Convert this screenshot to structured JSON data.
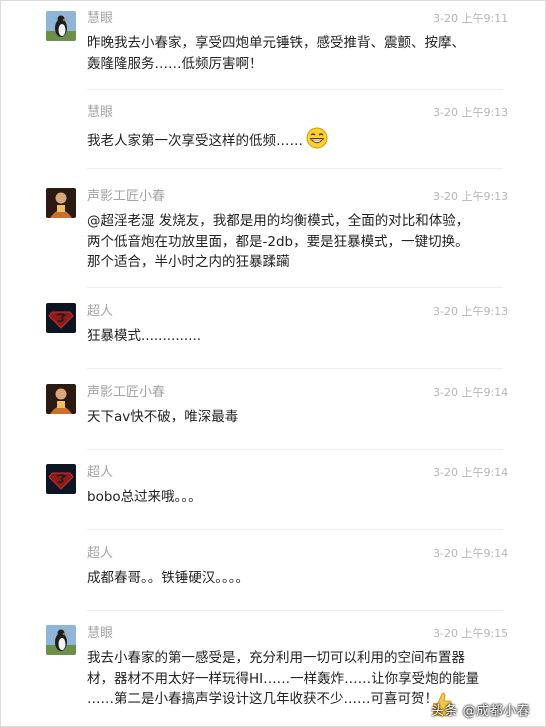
{
  "comments": [
    {
      "user": "慧眼",
      "time": "3-20 上午9:11",
      "lines": [
        "昨晚我去小春家，享受四炮单元锤铁，感受推背、震颤、按摩、",
        "轰隆隆服务……低频厉害啊！"
      ]
    },
    {
      "user": "慧眼",
      "time": "3-20 上午9:13",
      "lines": [
        "我老人家第一次享受这样的低频……"
      ]
    },
    {
      "user": "声影工匠小春",
      "time": "3-20 上午9:13",
      "lines": [
        "@超淫老湿 发烧友，我都是用的均衡模式，全面的对比和体验，",
        "两个低音炮在功放里面，都是-2db，要是狂暴模式，一键切换。",
        "那个适合，半小时之内的狂暴蹂躏"
      ]
    },
    {
      "user": "超人",
      "time": "3-20 上午9:13",
      "lines": [
        "狂暴模式.............."
      ]
    },
    {
      "user": "声影工匠小春",
      "time": "3-20 上午9:14",
      "lines": [
        "天下av快不破，唯深最毒"
      ]
    },
    {
      "user": "超人",
      "time": "3-20 上午9:14",
      "lines": [
        "bobo总过来哦。。。"
      ]
    },
    {
      "user": "超人",
      "time": "3-20 上午9:14",
      "lines": [
        "成都春哥。。铁锤硬汉。。。。"
      ]
    },
    {
      "user": "慧眼",
      "time": "3-20 上午9:15",
      "lines": [
        "我去小春家的第一感受是，充分利用一切可以利用的空间布置器",
        "材，器材不用太好一样玩得HI……一样轰炸……让你享受炮的能量",
        "……第二是小春搞声学设计这几年收获不少……可喜可贺！"
      ]
    }
  ],
  "watermark": "头条 @成都小春",
  "icons": {
    "emoji": "grinning-emoji-icon",
    "thumb": "thumbs-up-icon"
  }
}
